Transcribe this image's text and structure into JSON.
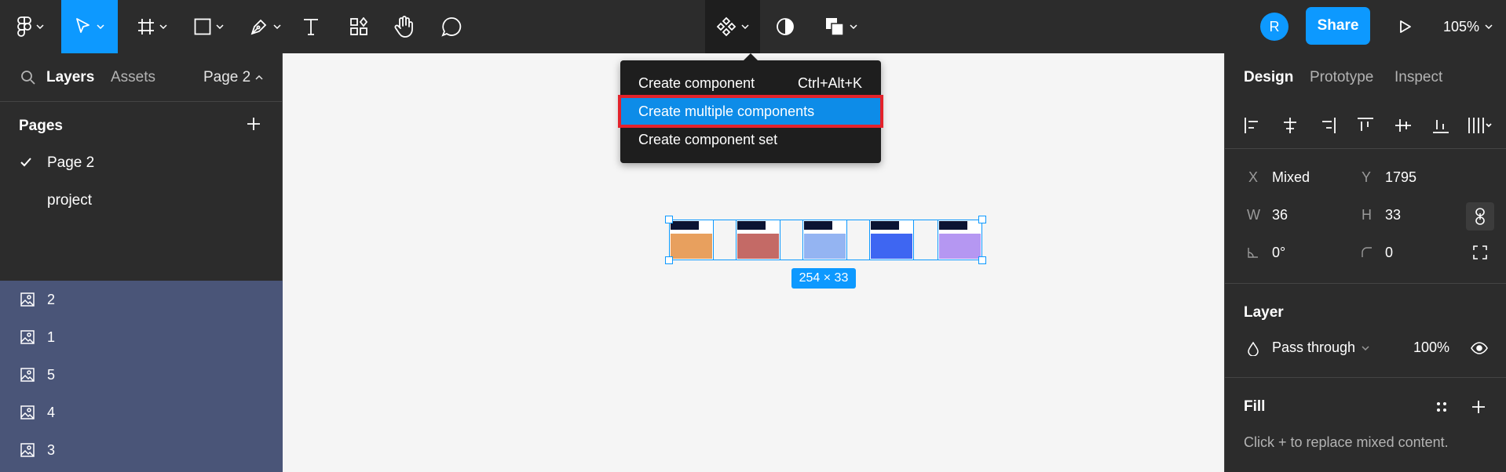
{
  "toolbar": {
    "tools": [
      {
        "name": "main-menu",
        "icon": "figma-logo-icon"
      },
      {
        "name": "move",
        "icon": "cursor-icon",
        "active": true
      },
      {
        "name": "frame",
        "icon": "frame-icon"
      },
      {
        "name": "shape",
        "icon": "rectangle-icon"
      },
      {
        "name": "pen",
        "icon": "pen-icon"
      },
      {
        "name": "text",
        "icon": "text-icon"
      },
      {
        "name": "resources",
        "icon": "resources-icon"
      },
      {
        "name": "hand",
        "icon": "hand-icon"
      },
      {
        "name": "comment",
        "icon": "comment-icon"
      }
    ],
    "center_tools": [
      "component-icon",
      "mask-icon",
      "boolean-icon"
    ],
    "avatar_initial": "R",
    "share_label": "Share",
    "zoom": "105%"
  },
  "left_panel": {
    "tab_layers": "Layers",
    "tab_assets": "Assets",
    "current_page": "Page 2",
    "pages_title": "Pages",
    "pages": [
      {
        "label": "Page 2",
        "selected": true
      },
      {
        "label": "project",
        "selected": false
      }
    ],
    "layers": [
      "2",
      "1",
      "5",
      "4",
      "3"
    ]
  },
  "dropdown": {
    "items": [
      {
        "label": "Create component",
        "shortcut": "Ctrl+Alt+K",
        "highlighted": false
      },
      {
        "label": "Create multiple components",
        "shortcut": "",
        "highlighted": true
      },
      {
        "label": "Create component set",
        "shortcut": "",
        "highlighted": false
      }
    ]
  },
  "canvas": {
    "selection_size": "254 × 33",
    "thumbnails": [
      {
        "name": "2",
        "color": "#e8a05e"
      },
      {
        "name": "1",
        "color": "#c46a66"
      },
      {
        "name": "5",
        "color": "#94b4f2"
      },
      {
        "name": "4",
        "color": "#3e66f2"
      },
      {
        "name": "3",
        "color": "#b597f2"
      }
    ]
  },
  "right_panel": {
    "tabs": [
      "Design",
      "Prototype",
      "Inspect"
    ],
    "x_label": "X",
    "x_value": "Mixed",
    "y_label": "Y",
    "y_value": "1795",
    "w_label": "W",
    "w_value": "36",
    "h_label": "H",
    "h_value": "33",
    "rotation": "0°",
    "radius": "0",
    "layer_title": "Layer",
    "blend_mode": "Pass through",
    "opacity": "100%",
    "fill_title": "Fill",
    "fill_hint": "Click + to replace mixed content."
  },
  "colors": {
    "accent": "#0d99ff",
    "panel": "#2c2c2c",
    "highlight_border": "#e3222b"
  }
}
